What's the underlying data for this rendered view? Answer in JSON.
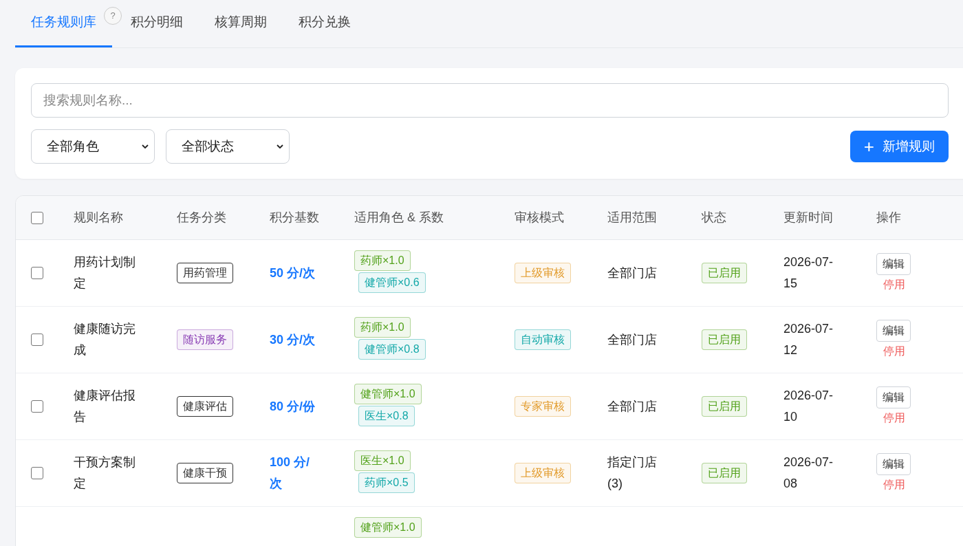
{
  "tabs": [
    {
      "label": "任务规则库",
      "selected": true
    },
    {
      "label": "积分明细",
      "selected": false
    },
    {
      "label": "核算周期",
      "selected": false
    },
    {
      "label": "积分兑换",
      "selected": false
    }
  ],
  "help": "?",
  "search": {
    "placeholder": "搜索规则名称..."
  },
  "filters": [
    {
      "value": "全部角色"
    },
    {
      "value": "全部状态"
    }
  ],
  "add_button": {
    "icon": "+",
    "label": "新增规则"
  },
  "table": {
    "columns": [
      "规则名称",
      "任务分类",
      "积分基数",
      "适用角色 & 系数",
      "审核模式",
      "适用范围",
      "状态",
      "更新时间",
      "操作"
    ],
    "header_checked": false,
    "rows": [
      {
        "checked": false,
        "name": "用药计划制定",
        "category": {
          "label": "用药管理",
          "color": "#333333"
        },
        "base": "50 分/次",
        "roles": [
          {
            "label": "药师×1.0",
            "color": "#52a11a"
          },
          {
            "label": "健管师×0.6",
            "color": "#13a8a8"
          }
        ],
        "audit": {
          "label": "上级审核",
          "color": "#e29b2b"
        },
        "scope": "全部门店",
        "status": {
          "label": "已启用",
          "color": "#52a11a"
        },
        "updated": "2026-07-15",
        "actions": [
          "编辑",
          "停用"
        ]
      },
      {
        "checked": false,
        "name": "健康随访完成",
        "category": {
          "label": "随访服务",
          "color": "#8a3fb5"
        },
        "base": "30 分/次",
        "roles": [
          {
            "label": "药师×1.0",
            "color": "#52a11a"
          },
          {
            "label": "健管师×0.8",
            "color": "#13a8a8"
          }
        ],
        "audit": {
          "label": "自动审核",
          "color": "#13a8a8"
        },
        "scope": "全部门店",
        "status": {
          "label": "已启用",
          "color": "#52a11a"
        },
        "updated": "2026-07-12",
        "actions": [
          "编辑",
          "停用"
        ]
      },
      {
        "checked": false,
        "name": "健康评估报告",
        "category": {
          "label": "健康评估",
          "color": "#333333"
        },
        "base": "80 分/份",
        "roles": [
          {
            "label": "健管师×1.0",
            "color": "#52a11a"
          },
          {
            "label": "医生×0.8",
            "color": "#13a8a8"
          }
        ],
        "audit": {
          "label": "专家审核",
          "color": "#e29b2b"
        },
        "scope": "全部门店",
        "status": {
          "label": "已启用",
          "color": "#52a11a"
        },
        "updated": "2026-07-10",
        "actions": [
          "编辑",
          "停用"
        ]
      },
      {
        "checked": false,
        "name": "干预方案制定",
        "category": {
          "label": "健康干预",
          "color": "#333333"
        },
        "base": "100 分/次",
        "roles": [
          {
            "label": "医生×1.0",
            "color": "#52a11a"
          },
          {
            "label": "药师×0.5",
            "color": "#13a8a8"
          }
        ],
        "audit": {
          "label": "上级审核",
          "color": "#e29b2b"
        },
        "scope": "指定门店 (3)",
        "status": {
          "label": "已启用",
          "color": "#52a11a"
        },
        "updated": "2026-07-08",
        "actions": [
          "编辑",
          "停用"
        ]
      },
      {
        "roles": [
          {
            "label": "健管师×1.0",
            "color": "#52a11a"
          }
        ]
      }
    ]
  }
}
